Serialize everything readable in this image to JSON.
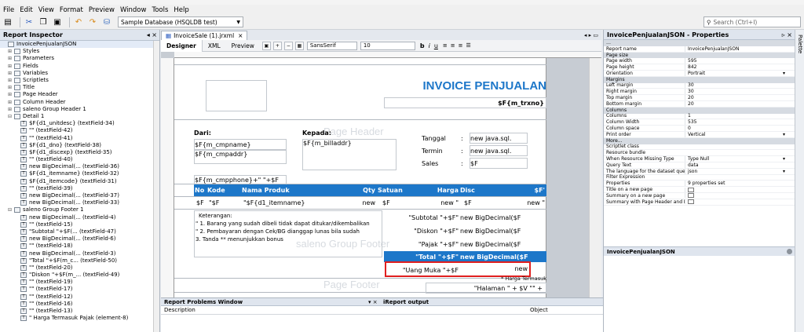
{
  "menu": [
    "File",
    "Edit",
    "View",
    "Format",
    "Preview",
    "Window",
    "Tools",
    "Help"
  ],
  "toolbar": {
    "database": "Sample Database (HSQLDB test)"
  },
  "search": {
    "placeholder": "Search (Ctrl+I)"
  },
  "inspector": {
    "title": "Report Inspector",
    "items": [
      {
        "label": "InvoicePenjualanJSON",
        "d": 0,
        "sel": true
      },
      {
        "label": "Styles",
        "d": 1,
        "exp": "+"
      },
      {
        "label": "Parameters",
        "d": 1,
        "exp": "+"
      },
      {
        "label": "Fields",
        "d": 1,
        "exp": "+"
      },
      {
        "label": "Variables",
        "d": 1,
        "exp": "+"
      },
      {
        "label": "Scriptlets",
        "d": 1,
        "exp": "+"
      },
      {
        "label": "Title",
        "d": 1,
        "exp": "+"
      },
      {
        "label": "Page Header",
        "d": 1,
        "exp": "+"
      },
      {
        "label": "Column Header",
        "d": 1,
        "exp": "+"
      },
      {
        "label": "saleno Group Header 1",
        "d": 1,
        "exp": "+"
      },
      {
        "label": "Detail 1",
        "d": 1,
        "exp": "-"
      },
      {
        "label": "$F{d1_unitdesc} (textField-34)",
        "d": 2
      },
      {
        "label": "\"\" (textField-42)",
        "d": 2
      },
      {
        "label": "\"\" (textField-41)",
        "d": 2
      },
      {
        "label": "$F{d1_dno} (textField-38)",
        "d": 2
      },
      {
        "label": "$F{d1_discexp} (textField-35)",
        "d": 2
      },
      {
        "label": "\"\" (textField-40)",
        "d": 2
      },
      {
        "label": "new BigDecimal(... (textField-36)",
        "d": 2
      },
      {
        "label": "$F{d1_itemname} (textField-32)",
        "d": 2
      },
      {
        "label": "$F{d1_itemcode} (textField-31)",
        "d": 2
      },
      {
        "label": "\"\" (textField-39)",
        "d": 2
      },
      {
        "label": "new BigDecimal(... (textField-37)",
        "d": 2
      },
      {
        "label": "new BigDecimal(... (textField-33)",
        "d": 2
      },
      {
        "label": "saleno Group Footer 1",
        "d": 1,
        "exp": "-"
      },
      {
        "label": "new BigDecimal(... (textField-4)",
        "d": 2
      },
      {
        "label": "\"\" (textField-15)",
        "d": 2
      },
      {
        "label": "\"Subtotal \"+$F(... (textField-47)",
        "d": 2
      },
      {
        "label": "new BigDecimal(... (textField-6)",
        "d": 2
      },
      {
        "label": "\"\" (textField-18)",
        "d": 2
      },
      {
        "label": "new BigDecimal(... (textField-3)",
        "d": 2
      },
      {
        "label": "\"Total \"+$F(m_c... (textField-50)",
        "d": 2
      },
      {
        "label": "\"\" (textField-20)",
        "d": 2
      },
      {
        "label": "\"Diskon \"+$F(m_... (textField-49)",
        "d": 2
      },
      {
        "label": "\"\" (textField-19)",
        "d": 2
      },
      {
        "label": "\"\" (textField-17)",
        "d": 2
      },
      {
        "label": "\"\" (textField-12)",
        "d": 2
      },
      {
        "label": "\"\" (textField-16)",
        "d": 2
      },
      {
        "label": "\"\" (textField-13)",
        "d": 2
      },
      {
        "label": "\" Harga Termasuk Pajak (element-8)",
        "d": 2
      }
    ]
  },
  "editor": {
    "file_tab": "InvoiceSale (1).jrxml",
    "views": [
      "Designer",
      "XML",
      "Preview"
    ],
    "font_name": "SansSerif",
    "font_size": "10"
  },
  "report": {
    "title": "INVOICE PENJUALAN",
    "trxno": "$F{m_trxno}",
    "dari": "Dari:",
    "kepada": "Kepada:",
    "cmpname": "$F{m_cmpname}",
    "cmpaddr": "$F{m_cmpaddr}",
    "billaddr": "$F{m_billaddr}",
    "cmpphone": "$F{m_cmpphone}+\" \"+$F",
    "tanggal": "Tanggal",
    "termin": "Termin",
    "sales": "Sales",
    "colon": ":",
    "tanggal_val": "new java.sql.",
    "termin_val": "new java.sql.",
    "sales_val": "$F",
    "band_page_header": "Page Header",
    "band_group_footer": "saleno Group Footer",
    "band_page_footer": "Page Footer",
    "col_no": "No",
    "col_kode": "Kode",
    "col_nama": "Nama Produk",
    "col_qty": "Qty",
    "col_satuan": "Satuan",
    "col_harga": "Harga",
    "col_disc": "Disc",
    "col_total": "$F'",
    "d_no": "$F",
    "d_kode": "\"$F",
    "d_nama": "\"$F{d1_itemname}",
    "d_qty": "new",
    "d_satuan": "$F",
    "d_harga": "new \"",
    "d_disc": "$F",
    "d_total": "new \"",
    "keterangan": "Keterangan:",
    "note1": "\" 1. Barang yang sudah dibeli tidak dapat ditukar/dikembalikan",
    "note2": "\" 2. Pembayaran dengan Cek/BG dianggap lunas bila sudah",
    "note3": "  3. Tanda ** menunjukkan bonus",
    "subtotal_label": "\"Subtotal \"+$F\"",
    "subtotal_val": "new BigDecimal($F",
    "diskon_label": "\"Diskon \"+$F\"",
    "diskon_val": "new BigDecimal($F",
    "pajak_label": "\"Pajak \"+$F\"",
    "pajak_val": "new BigDecimal($F",
    "total_label": "\"Total \"+$F\"",
    "total_val": "new BigDecimal($F",
    "uang_muka_label": "\"Uang Muka \"+$F",
    "uang_muka_val": "new",
    "harga_termasuk": "* Harga Termasuk",
    "halaman": "\"Halaman \" + $V  \"\" +"
  },
  "properties": {
    "title": "InvoicePenjualanJSON - Properties",
    "rows": [
      {
        "s": "…"
      },
      {
        "k": "Report name",
        "v": "InvoicePenjualanJSON"
      },
      {
        "s": "Page size"
      },
      {
        "k": "Page width",
        "v": "595"
      },
      {
        "k": "Page height",
        "v": "842"
      },
      {
        "k": "Orientation",
        "v": "Portrait",
        "dd": true
      },
      {
        "s": "Margins"
      },
      {
        "k": "Left margin",
        "v": "30"
      },
      {
        "k": "Right margin",
        "v": "30"
      },
      {
        "k": "Top margin",
        "v": "20"
      },
      {
        "k": "Bottom margin",
        "v": "20"
      },
      {
        "s": "Columns"
      },
      {
        "k": "Columns",
        "v": "1"
      },
      {
        "k": "Column Width",
        "v": "535"
      },
      {
        "k": "Column space",
        "v": "0"
      },
      {
        "k": "Print order",
        "v": "Vertical",
        "dd": true
      },
      {
        "s": "More..."
      },
      {
        "k": "Scriptlet class",
        "v": ""
      },
      {
        "k": "Resource bundle",
        "v": ""
      },
      {
        "k": "When Resource Missing Type",
        "v": "Type Null",
        "dd": true
      },
      {
        "k": "Query Text",
        "v": "data"
      },
      {
        "k": "The language for the dataset query",
        "v": "json",
        "dd": true
      },
      {
        "k": "Filter Expression",
        "v": ""
      },
      {
        "k": "Properties",
        "v": "9 properties set"
      },
      {
        "k": "Title on a new page",
        "v": "",
        "chk": true
      },
      {
        "k": "Summary on a new page",
        "v": "",
        "chk": true
      },
      {
        "k": "Summary with Page Header and Footer",
        "v": "",
        "chk": true
      }
    ],
    "footer": "InvoicePenjualanJSON"
  },
  "palette": "Palette",
  "problems": {
    "title": "Report Problems Window",
    "output": "iReport output",
    "col_desc": "Description",
    "col_obj": "Object"
  }
}
